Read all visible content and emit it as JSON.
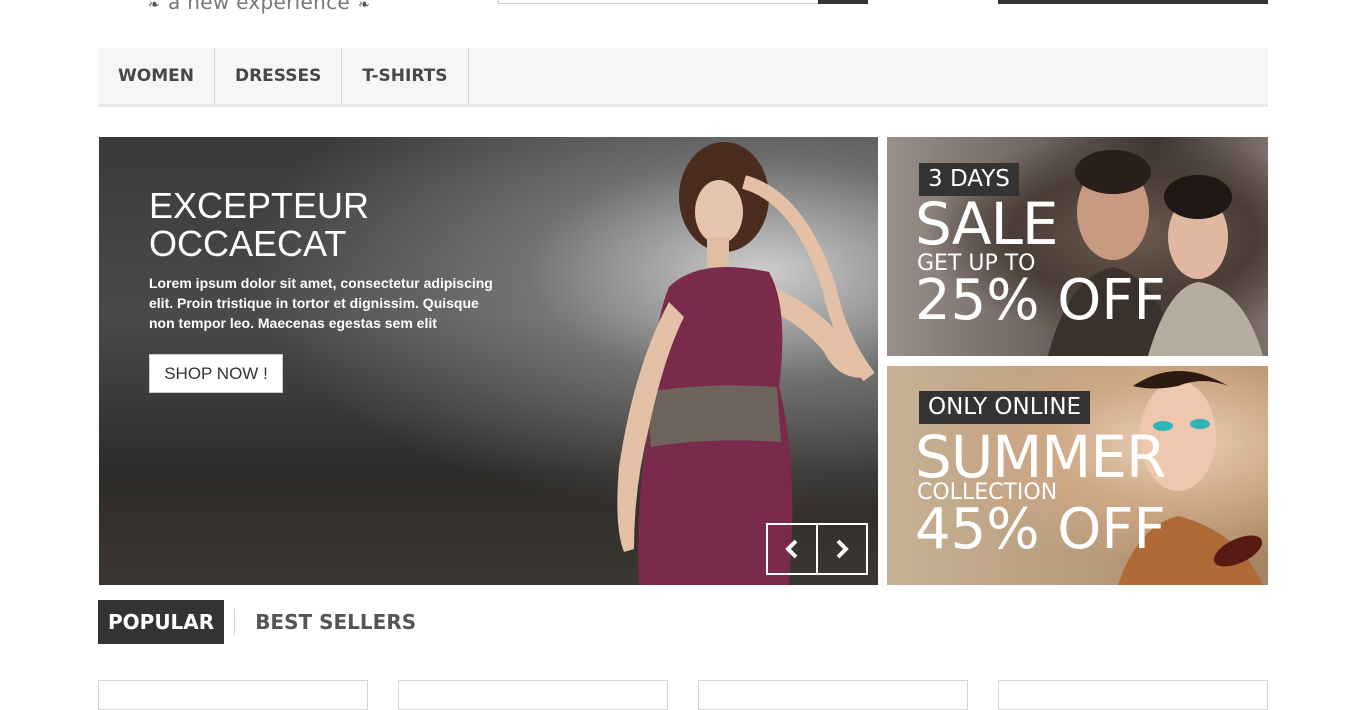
{
  "header": {
    "tagline": "a new experience"
  },
  "menu": {
    "items": [
      {
        "label": "WOMEN"
      },
      {
        "label": "DRESSES"
      },
      {
        "label": "T-SHIRTS"
      }
    ]
  },
  "slider": {
    "title_line1": "EXCEPTEUR",
    "title_line2": "OCCAECAT",
    "text": "Lorem ipsum dolor sit amet, consectetur adipiscing elit. Proin tristique in tortor et dignissim. Quisque non tempor leo. Maecenas egestas sem elit",
    "button_label": "SHOP NOW !"
  },
  "banners": [
    {
      "tag": "3 DAYS",
      "headline": "SALE",
      "subline": "GET UP TO",
      "offer": "25% OFF"
    },
    {
      "tag": "ONLY ONLINE",
      "headline": "SUMMER",
      "subline": "COLLECTION",
      "offer": "45% OFF"
    }
  ],
  "tabs": [
    {
      "label": "POPULAR",
      "active": true
    },
    {
      "label": "BEST SELLERS",
      "active": false
    }
  ],
  "colors": {
    "dark": "#333333",
    "menu_bg": "#f6f6f6",
    "accent_dress": "#7a2a4a"
  }
}
